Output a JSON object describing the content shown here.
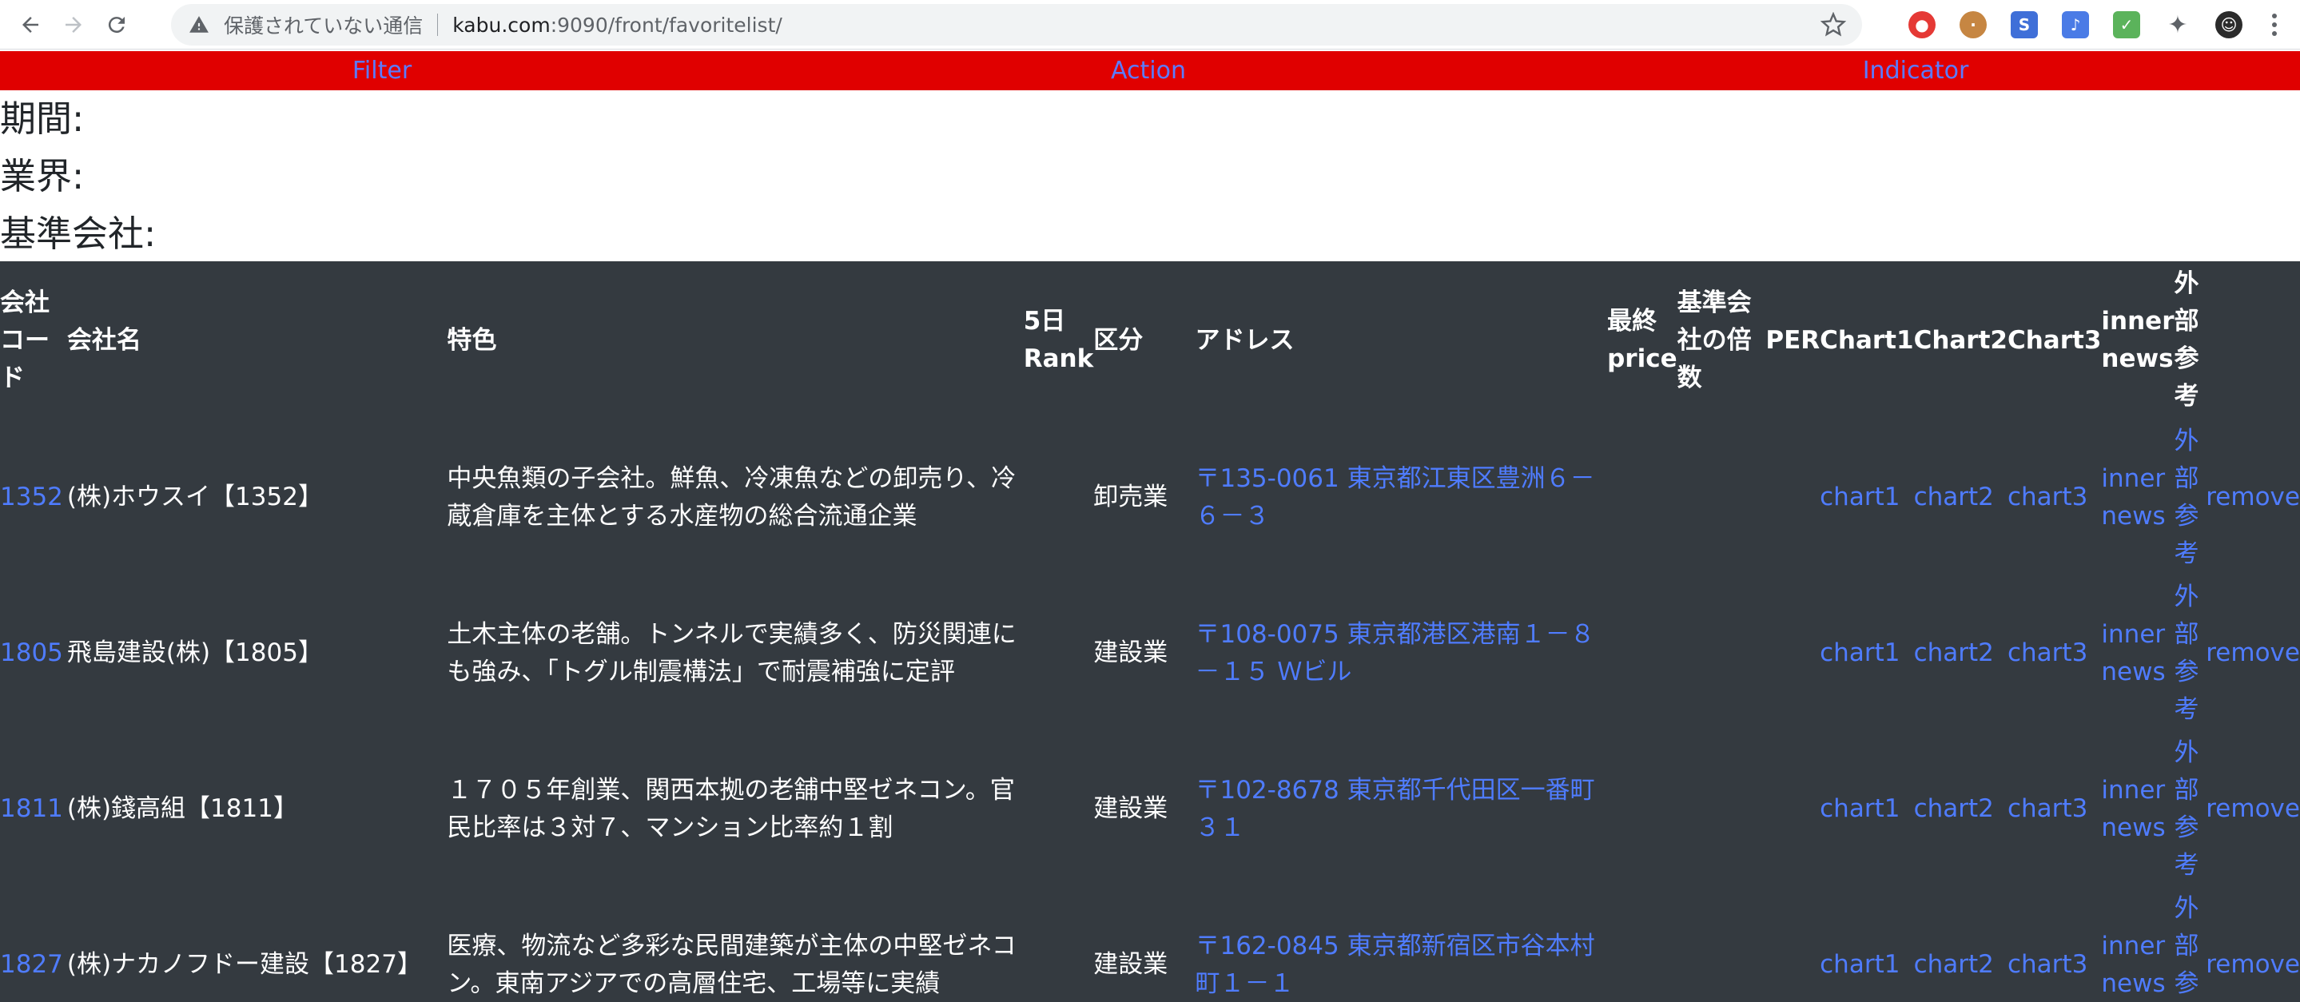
{
  "browser": {
    "insecure_label": "保護されていない通信",
    "url_host": "kabu.com",
    "url_path": ":9090/front/favoritelist/"
  },
  "nav": {
    "items": [
      "Filter",
      "Action",
      "Indicator"
    ]
  },
  "info": {
    "period_label": "期間:",
    "industry_label": "業界:",
    "base_company_label": "基準会社:"
  },
  "table": {
    "headers": {
      "code": "会社コード",
      "name": "会社名",
      "feature": "特色",
      "rank": "5日 Rank",
      "category": "区分",
      "address": "アドレス",
      "price": "最終 price",
      "multiple": "基準会社の倍数",
      "per": "PER",
      "chart1": "Chart1",
      "chart2": "Chart2",
      "chart3": "Chart3",
      "inner_news": "inner news",
      "external": "外部参考"
    },
    "rows": [
      {
        "code": "1352",
        "name": "(株)ホウスイ【1352】",
        "feature": "中央魚類の子会社。鮮魚、冷凍魚などの卸売り、冷蔵倉庫を主体とする水産物の総合流通企業",
        "category": "卸売業",
        "address": "〒135-0061 東京都江東区豊洲６－６－３",
        "chart1": "chart1",
        "chart2": "chart2",
        "chart3": "chart3",
        "inner_news": "inner news",
        "external": "外部参考",
        "remove": "remove"
      },
      {
        "code": "1805",
        "name": "飛島建設(株)【1805】",
        "feature": "土木主体の老舗。トンネルで実績多く、防災関連にも強み、「トグル制震構法」で耐震補強に定評",
        "category": "建設業",
        "address": "〒108-0075 東京都港区港南１－８－１５ Ｗビル",
        "chart1": "chart1",
        "chart2": "chart2",
        "chart3": "chart3",
        "inner_news": "inner news",
        "external": "外部参考",
        "remove": "remove"
      },
      {
        "code": "1811",
        "name": "(株)錢高組【1811】",
        "feature": "１７０５年創業、関西本拠の老舗中堅ゼネコン。官民比率は３対７、マンション比率約１割",
        "category": "建設業",
        "address": "〒102-8678 東京都千代田区一番町３１",
        "chart1": "chart1",
        "chart2": "chart2",
        "chart3": "chart3",
        "inner_news": "inner news",
        "external": "外部参考",
        "remove": "remove"
      },
      {
        "code": "1827",
        "name": "(株)ナカノフドー建設【1827】",
        "feature": "医療、物流など多彩な民間建築が主体の中堅ゼネコン。東南アジアでの高層住宅、工場等に実績",
        "category": "建設業",
        "address": "〒162-0845 東京都新宿区市谷本村町１－１",
        "chart1": "chart1",
        "chart2": "chart2",
        "chart3": "chart3",
        "inner_news": "inner news",
        "external": "外部参考",
        "remove": "remove"
      }
    ]
  },
  "colors": {
    "nav_bg": "#e00000",
    "nav_link": "#5b7bff",
    "table_bg": "#343a40",
    "link": "#4f7cff"
  }
}
